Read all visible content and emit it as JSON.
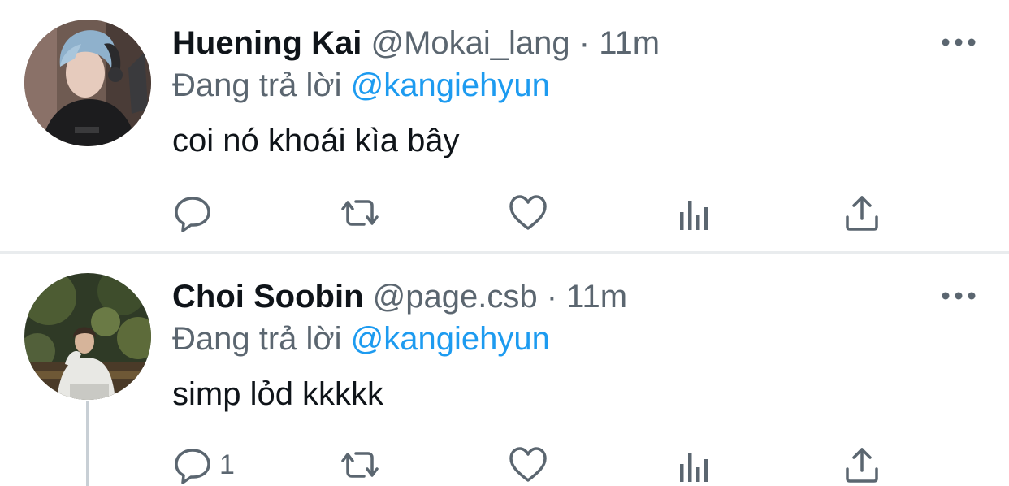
{
  "tweets": [
    {
      "name": "Huening Kai",
      "handle": "@Mokai_lang",
      "separator": "·",
      "time": "11m",
      "reply_prefix": "Đang trả lời",
      "reply_to": "@kangiehyun",
      "text": "coi nó khoái kìa bây",
      "reply_count": "",
      "icons": [
        "reply-icon",
        "retweet-icon",
        "like-icon",
        "analytics-icon",
        "share-icon",
        "more-icon"
      ]
    },
    {
      "name": "Choi Soobin",
      "handle": "@page.csb",
      "separator": "·",
      "time": "11m",
      "reply_prefix": "Đang trả lời",
      "reply_to": "@kangiehyun",
      "text": "simp lỏd kkkkk",
      "reply_count": "1",
      "icons": [
        "reply-icon",
        "retweet-icon",
        "like-icon",
        "analytics-icon",
        "share-icon",
        "more-icon"
      ]
    }
  ],
  "colors": {
    "text": "#0f1419",
    "secondary": "#5b6670",
    "link": "#1d9bf0",
    "divider": "#e9ecee"
  }
}
